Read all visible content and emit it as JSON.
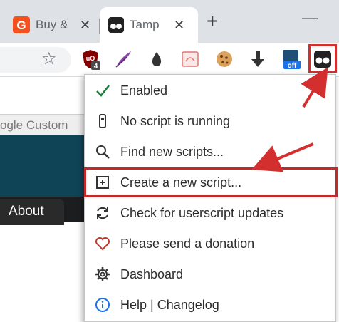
{
  "tabs": [
    {
      "title": "Buy &",
      "close": "✕"
    },
    {
      "title": "Tamp",
      "close": "✕"
    }
  ],
  "new_tab": "+",
  "minimize": "—",
  "toolbar": {
    "star": "☆",
    "badge_number": "4",
    "badge_off": "off"
  },
  "page": {
    "search_text": "ogle Custom",
    "about_tab": "About"
  },
  "menu": {
    "items": [
      {
        "label": "Enabled",
        "icon": "check-icon"
      },
      {
        "label": "No script is running",
        "icon": "script-icon"
      },
      {
        "label": "Find new scripts...",
        "icon": "search-icon"
      },
      {
        "label": "Create a new script...",
        "icon": "plus-box-icon"
      },
      {
        "label": "Check for userscript updates",
        "icon": "refresh-icon"
      },
      {
        "label": "Please send a donation",
        "icon": "heart-icon"
      },
      {
        "label": "Dashboard",
        "icon": "gear-icon"
      },
      {
        "label": "Help | Changelog",
        "icon": "info-icon"
      }
    ]
  },
  "colors": {
    "accent_red": "#d32f2f",
    "check_green": "#188038",
    "heart_red": "#c0392b",
    "info_blue": "#1a73e8"
  }
}
